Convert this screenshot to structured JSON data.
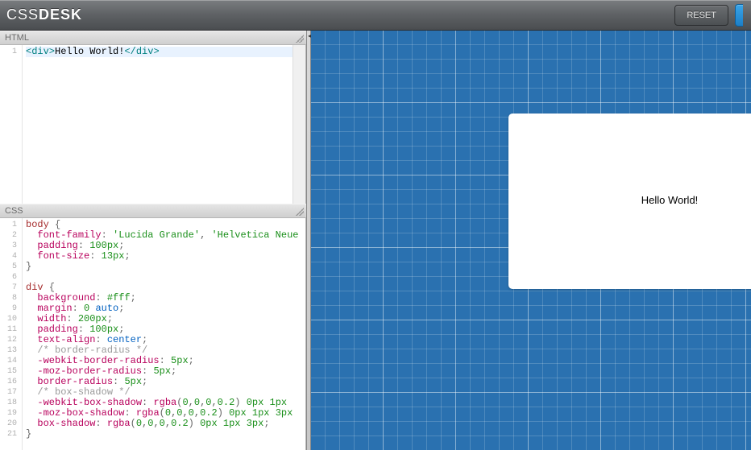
{
  "header": {
    "logo_light": "CSS",
    "logo_bold": "DESK",
    "reset_label": "RESET"
  },
  "panes": {
    "html_label": "HTML",
    "css_label": "CSS"
  },
  "html_code": {
    "line_numbers": [
      "1"
    ],
    "tokens": [
      [
        {
          "t": "<div>",
          "c": "tag"
        },
        {
          "t": "Hello World!",
          "c": "txt"
        },
        {
          "t": "</div>",
          "c": "tag"
        }
      ]
    ]
  },
  "css_code": {
    "line_numbers": [
      "1",
      "2",
      "3",
      "4",
      "5",
      "6",
      "7",
      "8",
      "9",
      "10",
      "11",
      "12",
      "13",
      "14",
      "15",
      "16",
      "17",
      "18",
      "19",
      "20",
      "21"
    ],
    "tokens": [
      [
        {
          "t": "body",
          "c": "sel"
        },
        {
          "t": " {",
          "c": "br"
        }
      ],
      [
        {
          "t": "  ",
          "c": ""
        },
        {
          "t": "font-family",
          "c": "prop"
        },
        {
          "t": ": ",
          "c": "br"
        },
        {
          "t": "'Lucida Grande'",
          "c": "val"
        },
        {
          "t": ", ",
          "c": "br"
        },
        {
          "t": "'Helvetica Neue",
          "c": "val"
        }
      ],
      [
        {
          "t": "  ",
          "c": ""
        },
        {
          "t": "padding",
          "c": "prop"
        },
        {
          "t": ": ",
          "c": "br"
        },
        {
          "t": "100px",
          "c": "num"
        },
        {
          "t": ";",
          "c": "br"
        }
      ],
      [
        {
          "t": "  ",
          "c": ""
        },
        {
          "t": "font-size",
          "c": "prop"
        },
        {
          "t": ": ",
          "c": "br"
        },
        {
          "t": "13px",
          "c": "num"
        },
        {
          "t": ";",
          "c": "br"
        }
      ],
      [
        {
          "t": "}",
          "c": "br"
        }
      ],
      [
        {
          "t": " ",
          "c": ""
        }
      ],
      [
        {
          "t": "div",
          "c": "sel"
        },
        {
          "t": " {",
          "c": "br"
        }
      ],
      [
        {
          "t": "  ",
          "c": ""
        },
        {
          "t": "background",
          "c": "prop"
        },
        {
          "t": ": ",
          "c": "br"
        },
        {
          "t": "#fff",
          "c": "num"
        },
        {
          "t": ";",
          "c": "br"
        }
      ],
      [
        {
          "t": "  ",
          "c": ""
        },
        {
          "t": "margin",
          "c": "prop"
        },
        {
          "t": ": ",
          "c": "br"
        },
        {
          "t": "0",
          "c": "num"
        },
        {
          "t": " ",
          "c": ""
        },
        {
          "t": "auto",
          "c": "kw"
        },
        {
          "t": ";",
          "c": "br"
        }
      ],
      [
        {
          "t": "  ",
          "c": ""
        },
        {
          "t": "width",
          "c": "prop"
        },
        {
          "t": ": ",
          "c": "br"
        },
        {
          "t": "200px",
          "c": "num"
        },
        {
          "t": ";",
          "c": "br"
        }
      ],
      [
        {
          "t": "  ",
          "c": ""
        },
        {
          "t": "padding",
          "c": "prop"
        },
        {
          "t": ": ",
          "c": "br"
        },
        {
          "t": "100px",
          "c": "num"
        },
        {
          "t": ";",
          "c": "br"
        }
      ],
      [
        {
          "t": "  ",
          "c": ""
        },
        {
          "t": "text-align",
          "c": "prop"
        },
        {
          "t": ": ",
          "c": "br"
        },
        {
          "t": "center",
          "c": "kw"
        },
        {
          "t": ";",
          "c": "br"
        }
      ],
      [
        {
          "t": "  ",
          "c": ""
        },
        {
          "t": "/* border-radius */",
          "c": "cm"
        }
      ],
      [
        {
          "t": "  ",
          "c": ""
        },
        {
          "t": "-webkit-border-radius",
          "c": "prop"
        },
        {
          "t": ": ",
          "c": "br"
        },
        {
          "t": "5px",
          "c": "num"
        },
        {
          "t": ";",
          "c": "br"
        }
      ],
      [
        {
          "t": "  ",
          "c": ""
        },
        {
          "t": "-moz-border-radius",
          "c": "prop"
        },
        {
          "t": ": ",
          "c": "br"
        },
        {
          "t": "5px",
          "c": "num"
        },
        {
          "t": ";",
          "c": "br"
        }
      ],
      [
        {
          "t": "  ",
          "c": ""
        },
        {
          "t": "border-radius",
          "c": "prop"
        },
        {
          "t": ": ",
          "c": "br"
        },
        {
          "t": "5px",
          "c": "num"
        },
        {
          "t": ";",
          "c": "br"
        }
      ],
      [
        {
          "t": "  ",
          "c": ""
        },
        {
          "t": "/* box-shadow */",
          "c": "cm"
        }
      ],
      [
        {
          "t": "  ",
          "c": ""
        },
        {
          "t": "-webkit-box-shadow",
          "c": "prop"
        },
        {
          "t": ": ",
          "c": "br"
        },
        {
          "t": "rgba",
          "c": "fn"
        },
        {
          "t": "(",
          "c": "br"
        },
        {
          "t": "0",
          "c": "num"
        },
        {
          "t": ",",
          "c": "br"
        },
        {
          "t": "0",
          "c": "num"
        },
        {
          "t": ",",
          "c": "br"
        },
        {
          "t": "0",
          "c": "num"
        },
        {
          "t": ",",
          "c": "br"
        },
        {
          "t": "0.2",
          "c": "num"
        },
        {
          "t": ") ",
          "c": "br"
        },
        {
          "t": "0px",
          "c": "num"
        },
        {
          "t": " ",
          "c": ""
        },
        {
          "t": "1px",
          "c": "num"
        },
        {
          "t": " ",
          "c": ""
        }
      ],
      [
        {
          "t": "  ",
          "c": ""
        },
        {
          "t": "-moz-box-shadow",
          "c": "prop"
        },
        {
          "t": ": ",
          "c": "br"
        },
        {
          "t": "rgba",
          "c": "fn"
        },
        {
          "t": "(",
          "c": "br"
        },
        {
          "t": "0",
          "c": "num"
        },
        {
          "t": ",",
          "c": "br"
        },
        {
          "t": "0",
          "c": "num"
        },
        {
          "t": ",",
          "c": "br"
        },
        {
          "t": "0",
          "c": "num"
        },
        {
          "t": ",",
          "c": "br"
        },
        {
          "t": "0.2",
          "c": "num"
        },
        {
          "t": ") ",
          "c": "br"
        },
        {
          "t": "0px",
          "c": "num"
        },
        {
          "t": " ",
          "c": ""
        },
        {
          "t": "1px",
          "c": "num"
        },
        {
          "t": " ",
          "c": ""
        },
        {
          "t": "3px",
          "c": "num"
        }
      ],
      [
        {
          "t": "  ",
          "c": ""
        },
        {
          "t": "box-shadow",
          "c": "prop"
        },
        {
          "t": ": ",
          "c": "br"
        },
        {
          "t": "rgba",
          "c": "fn"
        },
        {
          "t": "(",
          "c": "br"
        },
        {
          "t": "0",
          "c": "num"
        },
        {
          "t": ",",
          "c": "br"
        },
        {
          "t": "0",
          "c": "num"
        },
        {
          "t": ",",
          "c": "br"
        },
        {
          "t": "0",
          "c": "num"
        },
        {
          "t": ",",
          "c": "br"
        },
        {
          "t": "0.2",
          "c": "num"
        },
        {
          "t": ") ",
          "c": "br"
        },
        {
          "t": "0px",
          "c": "num"
        },
        {
          "t": " ",
          "c": ""
        },
        {
          "t": "1px",
          "c": "num"
        },
        {
          "t": " ",
          "c": ""
        },
        {
          "t": "3px",
          "c": "num"
        },
        {
          "t": ";",
          "c": "br"
        }
      ],
      [
        {
          "t": "}",
          "c": "br"
        }
      ]
    ]
  },
  "preview": {
    "card_text": "Hello World!"
  }
}
